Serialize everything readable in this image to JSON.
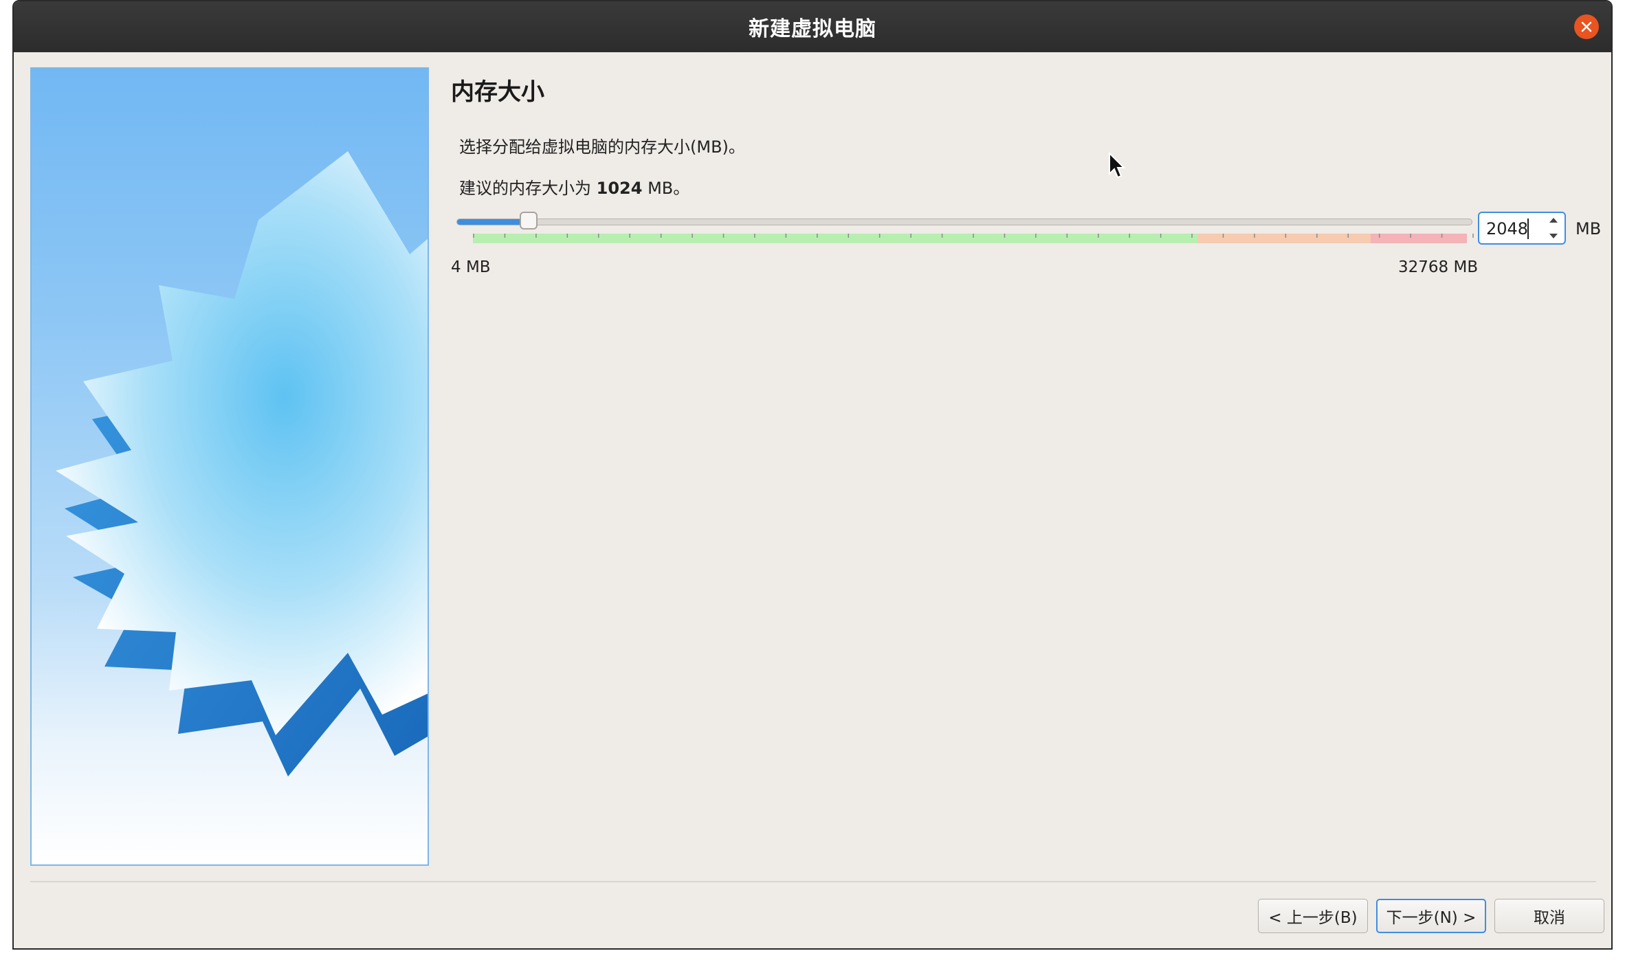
{
  "window": {
    "title": "新建虚拟电脑"
  },
  "page": {
    "heading": "内存大小",
    "description": "选择分配给虚拟电脑的内存大小(MB)。",
    "recommended_prefix": "建议的内存大小为 ",
    "recommended_value": "1024",
    "recommended_suffix": " MB。"
  },
  "memory": {
    "min_label": "4 MB",
    "max_label": "32768 MB",
    "min_mb": 4,
    "max_mb": 32768,
    "value_mb": 2048,
    "value_text": "2048",
    "unit": "MB"
  },
  "buttons": {
    "back": "< 上一步(B)",
    "next": "下一步(N) >",
    "cancel": "取消"
  },
  "colors": {
    "accent": "#3d8ee0",
    "close_button": "#e95420",
    "range_ok": "#b8efb0",
    "range_warn": "#f6cbb0",
    "range_danger": "#f4b3b6"
  },
  "icons": {
    "close": "close-icon",
    "spin_up": "arrow-up-icon",
    "spin_down": "arrow-down-icon",
    "cursor": "mouse-pointer-icon"
  }
}
